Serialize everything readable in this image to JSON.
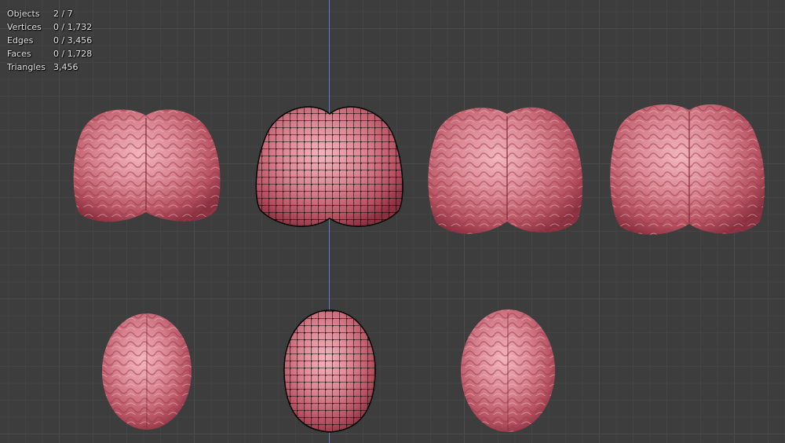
{
  "overlay_stats": [
    {
      "label": "Objects",
      "value": "2 / 7"
    },
    {
      "label": "Vertices",
      "value": "0 / 1,732"
    },
    {
      "label": "Edges",
      "value": "0 / 3,456"
    },
    {
      "label": "Faces",
      "value": "0 / 1,728"
    },
    {
      "label": "Triangles",
      "value": "3,456"
    }
  ],
  "colors": {
    "background": "#3d3d3d",
    "grid": "#4b4b4b",
    "axis": "#5a80c8",
    "tissue": "#d97f8c",
    "wire": "#000000"
  }
}
